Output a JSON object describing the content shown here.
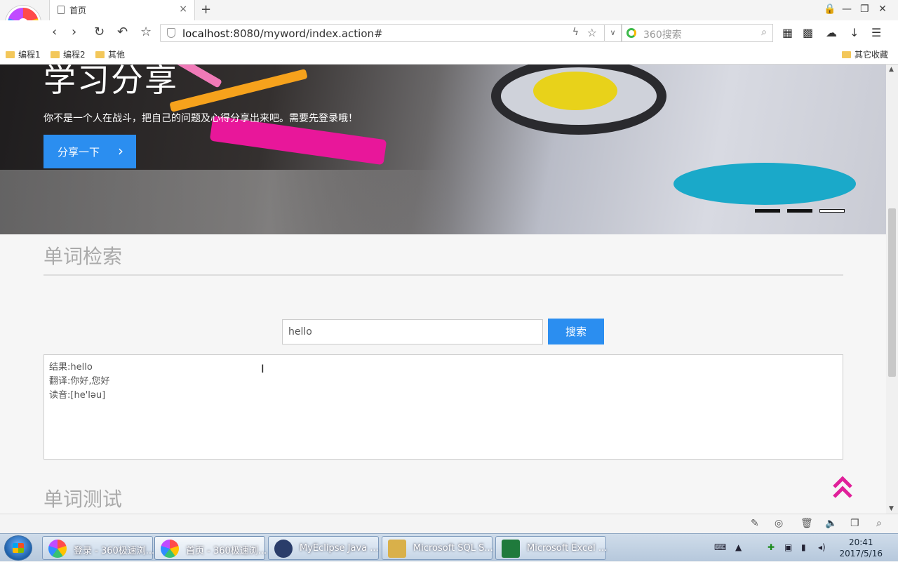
{
  "browser": {
    "tab_title": "首页",
    "tab_close": "×",
    "new_tab": "+",
    "window_controls": [
      "🔒",
      "—",
      "❐",
      "✕"
    ],
    "url_host": "localhost",
    "url_rest": ":8080/myword/index.action#",
    "search_placeholder": "360搜索",
    "bookmarks": [
      "编程1",
      "编程2",
      "其他"
    ],
    "bookmarks_right": "其它收藏"
  },
  "hero": {
    "title": "学习分享",
    "subtitle": "你不是一个人在战斗，把自己的问题及心得分享出来吧。需要先登录哦！",
    "share_button": "分享一下",
    "active_slide": 3,
    "slide_count": 3
  },
  "search_section": {
    "title": "单词检索",
    "input_value": "hello",
    "button": "搜索",
    "result_lines": [
      "结果:hello",
      "翻译:你好,您好",
      "读音:[he'ləu]"
    ]
  },
  "test_section": {
    "title": "单词测试"
  },
  "taskbar": {
    "items": [
      {
        "label": "登录 - 360极速浏...",
        "icon": "360-browser-icon"
      },
      {
        "label": "首页 - 360极速浏...",
        "icon": "360-browser-icon"
      },
      {
        "label": "MyEclipse Java ...",
        "icon": "myeclipse-icon"
      },
      {
        "label": "Microsoft SQL S...",
        "icon": "sql-server-icon"
      },
      {
        "label": "Microsoft Excel ...",
        "icon": "excel-icon"
      }
    ],
    "active_index": 1,
    "time": "20:41",
    "date": "2017/5/16"
  },
  "colors": {
    "accent": "#2b8ef0",
    "back_to_top": "#e0209a"
  }
}
